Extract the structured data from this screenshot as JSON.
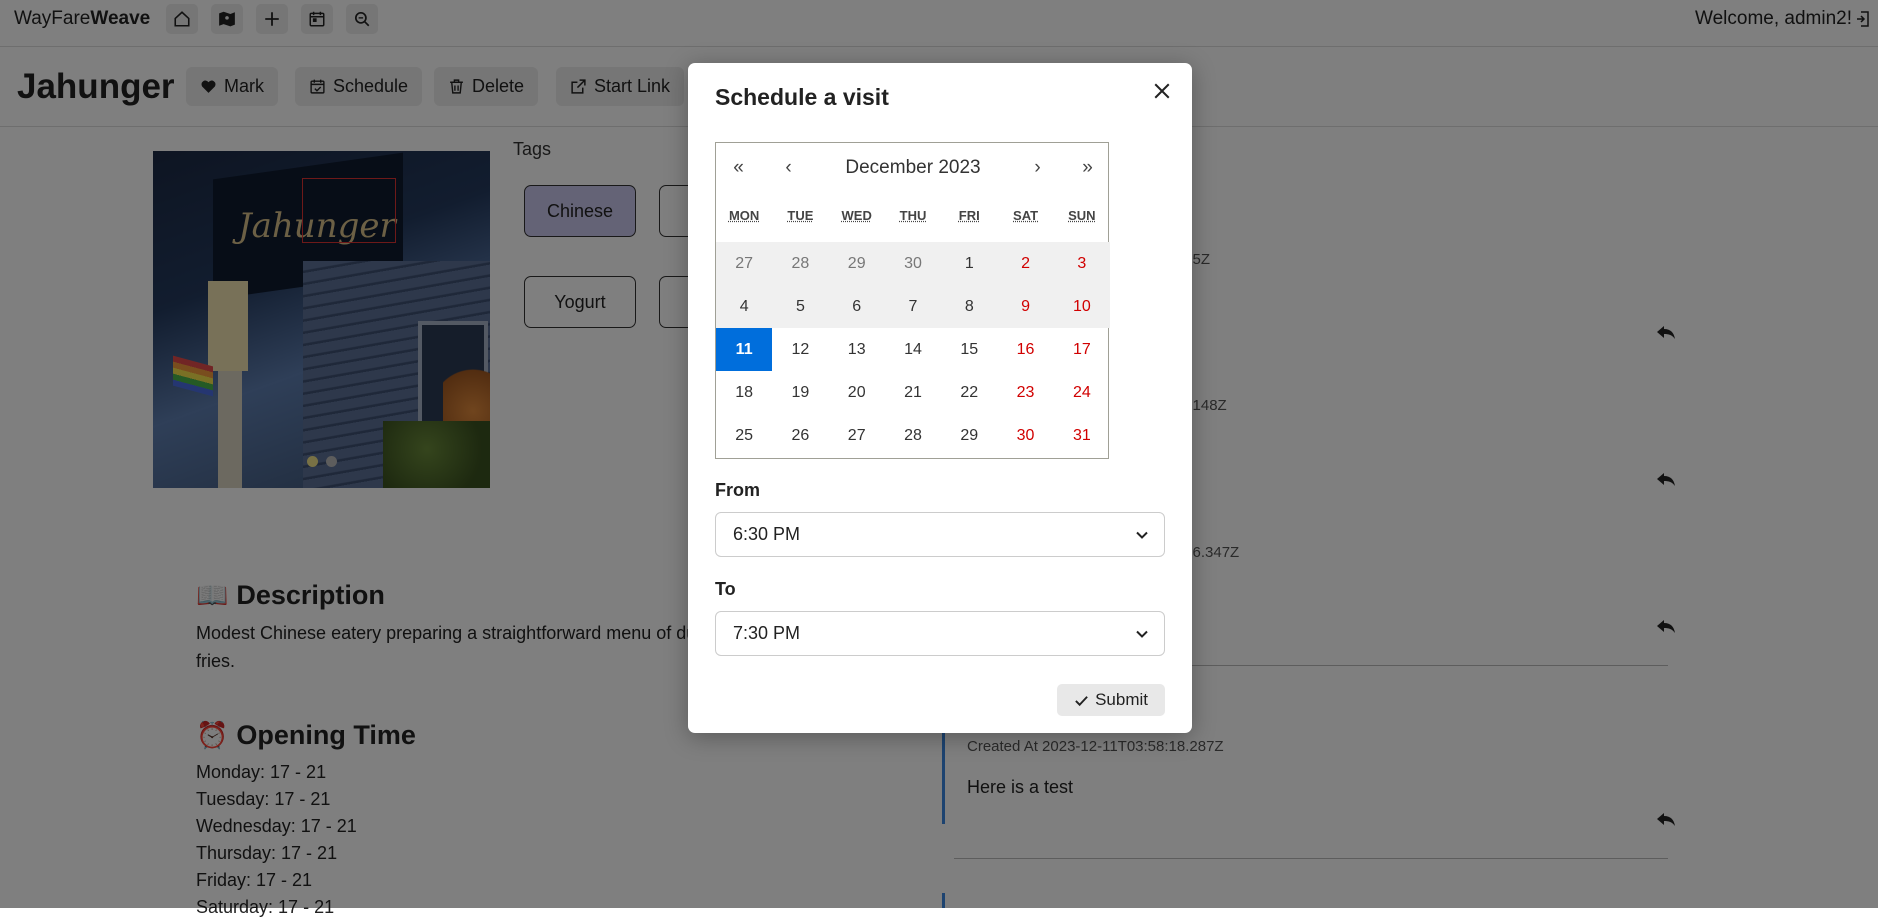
{
  "nav": {
    "brand_light": "WayFare",
    "brand_bold": "Weave",
    "welcome": "Welcome, admin2!",
    "icons": [
      "home-icon",
      "map-icon",
      "plus-icon",
      "calendar-icon",
      "search-icon"
    ]
  },
  "header": {
    "title": "Jahunger",
    "buttons": [
      {
        "label": "Mark",
        "icon": "heart-icon"
      },
      {
        "label": "Schedule",
        "icon": "calendar-check-icon"
      },
      {
        "label": "Delete",
        "icon": "trash-icon"
      },
      {
        "label": "Start Link",
        "icon": "external-link-icon"
      }
    ]
  },
  "photo": {
    "sign_text": "Jahunger",
    "slides": 2,
    "active_slide": 1
  },
  "tags": {
    "label": "Tags",
    "items": [
      "Chinese",
      "Yogurt"
    ]
  },
  "description": {
    "icon": "📖",
    "title": "Description",
    "text": "Modest Chinese eatery preparing a straightforward menu of du",
    "text2": "fries."
  },
  "opening": {
    "icon": "⏰",
    "title": "Opening Time",
    "hours": [
      "Monday: 17 - 21",
      "Tuesday: 17 - 21",
      "Wednesday: 17 - 21",
      "Thursday: 17 - 21",
      "Friday: 17 - 21",
      "Saturday: 17 - 21"
    ]
  },
  "comments": {
    "partial_timestamps": [
      ".35Z",
      "5.148Z",
      ":36.347Z"
    ],
    "created_at": "Created At 2023-12-11T03:58:18.287Z",
    "text": "Here is a test"
  },
  "modal": {
    "title": "Schedule a visit",
    "calendar": {
      "month_label": "December 2023",
      "nav": {
        "prev_year": "«",
        "prev_month": "‹",
        "next_month": "›",
        "next_year": "»"
      },
      "weekdays": [
        "MON",
        "TUE",
        "WED",
        "THU",
        "FRI",
        "SAT",
        "SUN"
      ],
      "weeks": [
        [
          "27",
          "28",
          "29",
          "30",
          "1",
          "2",
          "3"
        ],
        [
          "4",
          "5",
          "6",
          "7",
          "8",
          "9",
          "10"
        ],
        [
          "11",
          "12",
          "13",
          "14",
          "15",
          "16",
          "17"
        ],
        [
          "18",
          "19",
          "20",
          "21",
          "22",
          "23",
          "24"
        ],
        [
          "25",
          "26",
          "27",
          "28",
          "29",
          "30",
          "31"
        ]
      ],
      "selected_day": "11"
    },
    "from_label": "From",
    "from_value": "6:30 PM",
    "to_label": "To",
    "to_value": "7:30 PM",
    "submit_label": "Submit"
  },
  "colors": {
    "accent": "#006edc",
    "weekend": "#d10000",
    "tag_selected": "#c8c6ec",
    "comment_bar": "#3a86e0"
  }
}
